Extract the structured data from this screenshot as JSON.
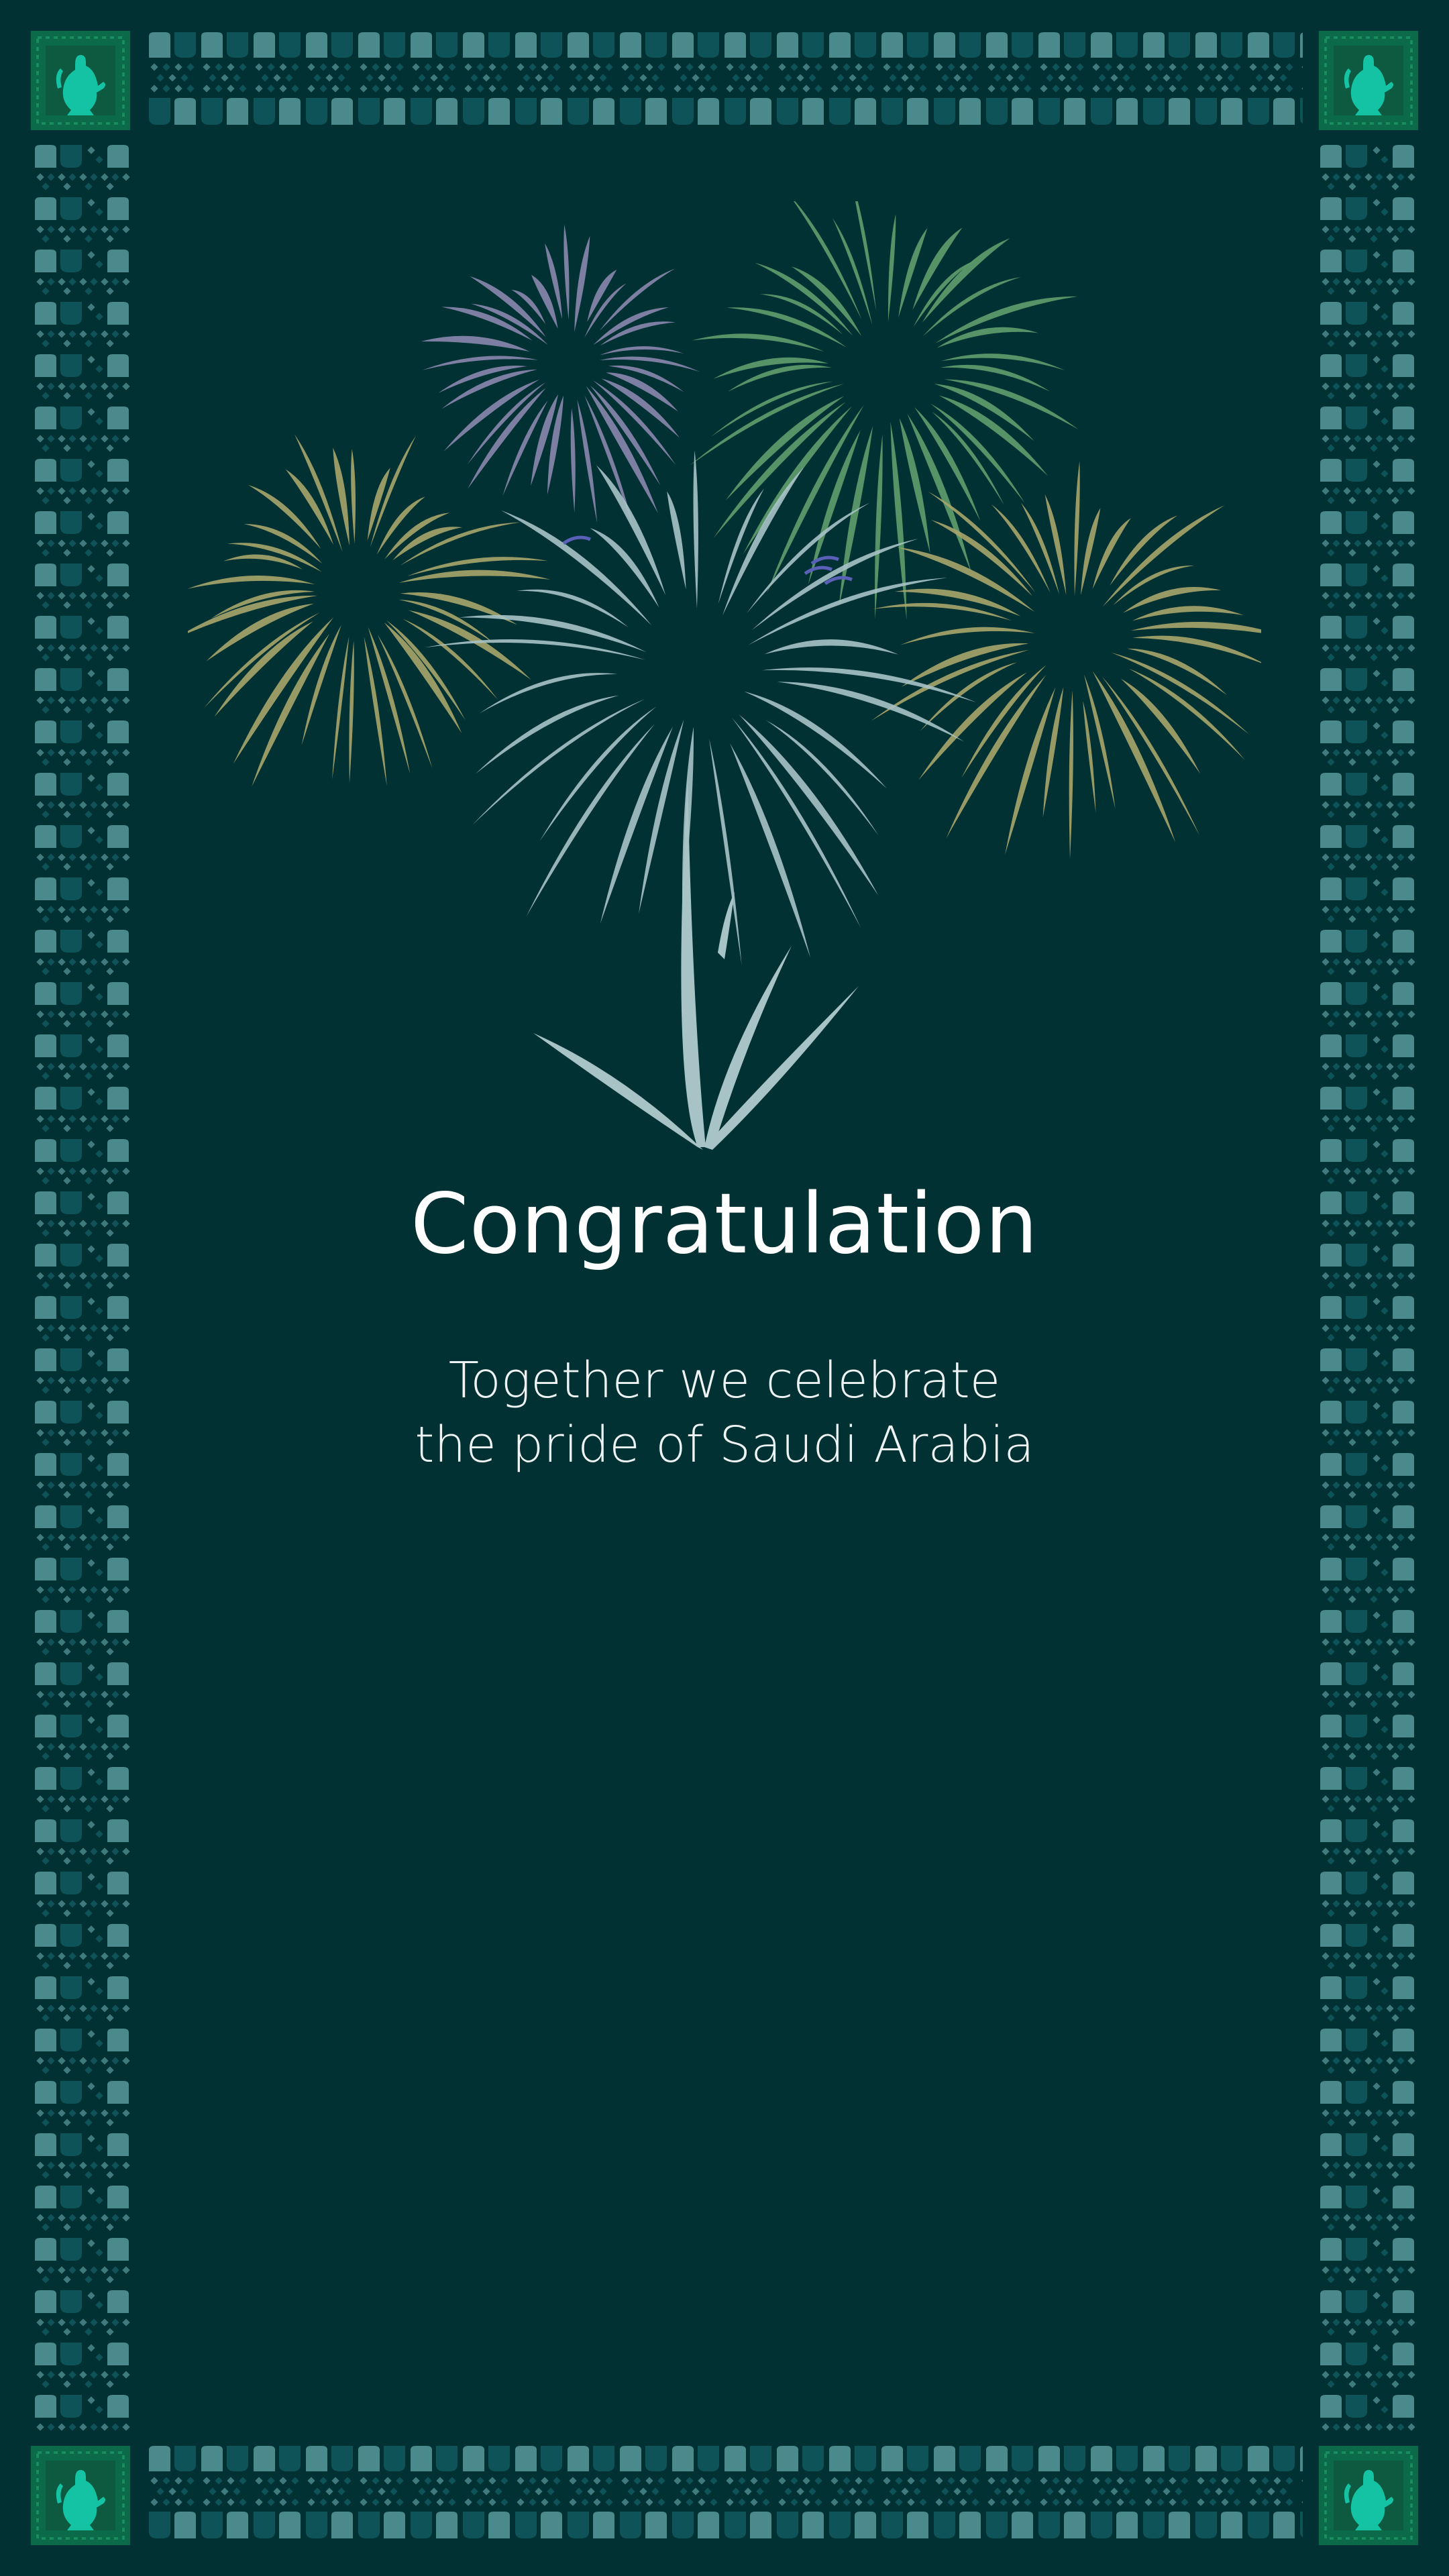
{
  "card": {
    "title": "Congratulation",
    "message_line_1": "Together we celebrate",
    "message_line_2": "the pride of Saudi Arabia"
  },
  "decoration": {
    "border_pattern": "sadu-pattern",
    "corner_icon": "dallah-coffee-pot-icon",
    "illustration": "fireworks-palm-illustration"
  },
  "colors": {
    "background": "#023134",
    "pattern_light": "#4a8a8c",
    "pattern_dark": "#0d5358",
    "corner_green": "#0b6a4a",
    "firework_lilac": "#8a88ae",
    "firework_green": "#5f9e6c",
    "firework_olive": "#a8a66a",
    "firework_pale": "#a7c3c6",
    "text": "#ffffff"
  }
}
